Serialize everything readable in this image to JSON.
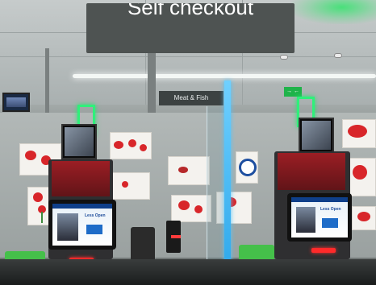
{
  "scene": {
    "overhead_sign": {
      "text": "Self checkout"
    },
    "aisle_sign": {
      "text": "Meat & Fish"
    },
    "exit_sign": {
      "text": "→ ←"
    },
    "kiosk_left": {
      "screen_title": "Less Open"
    },
    "kiosk_right": {
      "screen_title": "Less Open"
    }
  },
  "colors": {
    "accent_green": "#2ff07a",
    "divider_blue": "#2aa6ea",
    "kiosk_red": "#9b1e24"
  }
}
